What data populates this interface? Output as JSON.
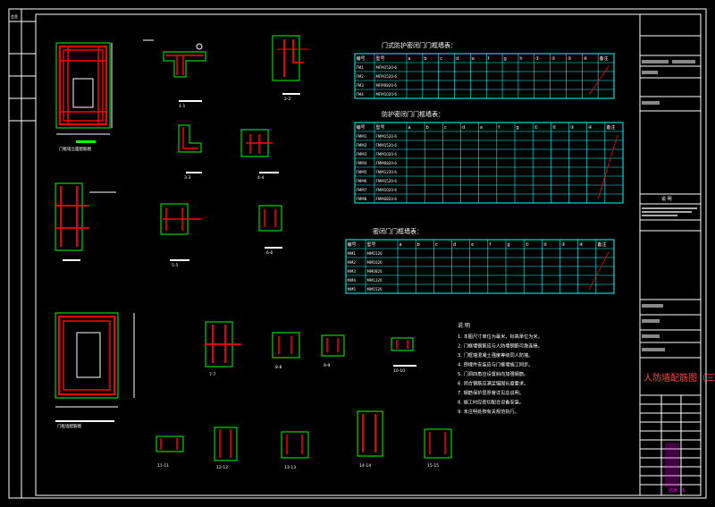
{
  "sheet": {
    "title_block": {
      "project_label": "建设单位",
      "project_value": "",
      "notes_label": "说 明",
      "drawing_title": "人防墙配筋图（三）",
      "sheet_no": "结施-11",
      "fields": [
        "图名",
        "图号",
        "比例",
        "日期"
      ]
    },
    "tables": [
      {
        "title": "门式防护密闭门门框墙表：",
        "headers": [
          "编号",
          "型号",
          "a",
          "b",
          "c",
          "d",
          "e",
          "f",
          "g",
          "h",
          "①",
          "②",
          "③",
          "④",
          "备注"
        ],
        "rows": [
          [
            "FM1",
            "MFM1520-6",
            "",
            "",
            "",
            "",
            "",
            "",
            "",
            "",
            "",
            "",
            "",
            "",
            ""
          ],
          [
            "FM2",
            "MFM1520-6",
            "",
            "",
            "",
            "",
            "",
            "",
            "",
            "",
            "",
            "",
            "",
            "",
            ""
          ],
          [
            "FM3",
            "MFM0820-6",
            "",
            "",
            "",
            "",
            "",
            "",
            "",
            "",
            "",
            "",
            "",
            "",
            ""
          ],
          [
            "FM4",
            "MFM1020-6",
            "",
            "",
            "",
            "",
            "",
            "",
            "",
            "",
            "",
            "",
            "",
            "",
            ""
          ]
        ]
      },
      {
        "title": "防护密闭门门框墙表：",
        "headers": [
          "编号",
          "型号",
          "a",
          "b",
          "c",
          "d",
          "e",
          "f",
          "g",
          "①",
          "②",
          "③",
          "④",
          "备注"
        ],
        "rows": [
          [
            "FMM1",
            "FMM1520-6",
            "",
            "",
            "",
            "",
            "",
            "",
            "",
            "",
            "",
            "",
            "",
            ""
          ],
          [
            "FMM2",
            "FMM1520-6",
            "",
            "",
            "",
            "",
            "",
            "",
            "",
            "",
            "",
            "",
            "",
            ""
          ],
          [
            "FMM3",
            "FMM1020-6",
            "",
            "",
            "",
            "",
            "",
            "",
            "",
            "",
            "",
            "",
            "",
            ""
          ],
          [
            "FMM4",
            "FMM0820-6",
            "",
            "",
            "",
            "",
            "",
            "",
            "",
            "",
            "",
            "",
            "",
            ""
          ],
          [
            "FMM5",
            "FMM1220-6",
            "",
            "",
            "",
            "",
            "",
            "",
            "",
            "",
            "",
            "",
            "",
            ""
          ],
          [
            "FMM6",
            "FMM1520-6",
            "",
            "",
            "",
            "",
            "",
            "",
            "",
            "",
            "",
            "",
            "",
            ""
          ],
          [
            "FMM7",
            "FMM1020-6",
            "",
            "",
            "",
            "",
            "",
            "",
            "",
            "",
            "",
            "",
            "",
            ""
          ],
          [
            "FMM8",
            "FMM0820-6",
            "",
            "",
            "",
            "",
            "",
            "",
            "",
            "",
            "",
            "",
            "",
            ""
          ]
        ]
      },
      {
        "title": "密闭门门框墙表：",
        "headers": [
          "编号",
          "型号",
          "a",
          "b",
          "c",
          "d",
          "e",
          "f",
          "g",
          "①",
          "②",
          "③",
          "④",
          "备注"
        ],
        "rows": [
          [
            "MM1",
            "MM1520",
            "",
            "",
            "",
            "",
            "",
            "",
            "",
            "",
            "",
            "",
            "",
            ""
          ],
          [
            "MM2",
            "MM1020",
            "",
            "",
            "",
            "",
            "",
            "",
            "",
            "",
            "",
            "",
            "",
            ""
          ],
          [
            "MM3",
            "MM0820",
            "",
            "",
            "",
            "",
            "",
            "",
            "",
            "",
            "",
            "",
            "",
            ""
          ],
          [
            "MM4",
            "MM1220",
            "",
            "",
            "",
            "",
            "",
            "",
            "",
            "",
            "",
            "",
            "",
            ""
          ],
          [
            "MM5",
            "MM1520",
            "",
            "",
            "",
            "",
            "",
            "",
            "",
            "",
            "",
            "",
            "",
            ""
          ]
        ]
      }
    ],
    "notes_title": "说 明",
    "notes": [
      "1. 本图尺寸单位为毫米，标高单位为米。",
      "2. 门框墙钢筋应与人防墙钢筋可靠连接。",
      "3. 门框墙混凝土强度等级同人防墙。",
      "4. 预埋件安装应与门框墙施工同步。",
      "5. 门洞四角应设置斜向加强钢筋。",
      "6. 闭合钢筋应满足锚固长度要求。",
      "7. 钢筋保护层厚度详见总说明。",
      "8. 施工时应密切配合设备安装。",
      "9. 未注明处按有关规范执行。"
    ],
    "details": [
      {
        "label": "门框墙立面配筋图"
      },
      {
        "label": "1-1"
      },
      {
        "label": "2-2"
      },
      {
        "label": "3-3"
      },
      {
        "label": "4-4"
      },
      {
        "label": "5-5"
      },
      {
        "label": "6-6"
      },
      {
        "label": "门框墙配筋图"
      },
      {
        "label": "7-7"
      },
      {
        "label": "8-8"
      },
      {
        "label": "9-9"
      },
      {
        "label": "10-10"
      },
      {
        "label": "11-11"
      },
      {
        "label": "12-12"
      },
      {
        "label": "13-13"
      },
      {
        "label": "14-14"
      },
      {
        "label": "15-15"
      }
    ],
    "colors": {
      "frame": "#ffffff",
      "rebar": "#ff0000",
      "concrete": "#00ff00",
      "table": "#00ffff",
      "text": "#ffffff",
      "highlight": "#ff00ff",
      "dim": "#ffff00"
    }
  }
}
